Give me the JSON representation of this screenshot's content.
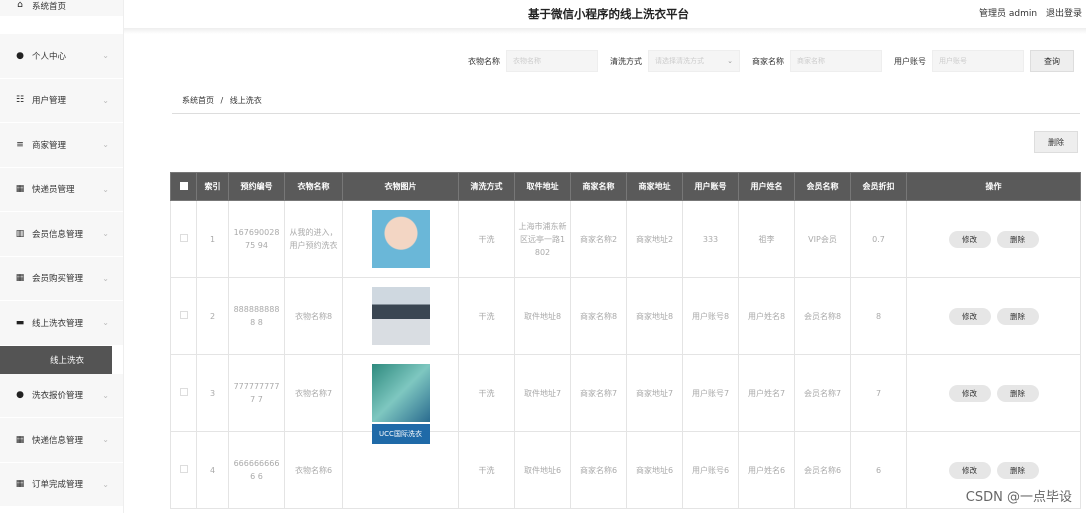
{
  "app": {
    "title": "基于微信小程序的线上洗衣平台",
    "user": "管理员 admin",
    "logout": "退出登录"
  },
  "sidebar": {
    "items": [
      {
        "label": "系统首页",
        "icon": "home-icon",
        "glyph": "⌂"
      },
      {
        "label": "个人中心",
        "icon": "user-icon",
        "glyph": "●"
      },
      {
        "label": "用户管理",
        "icon": "sliders-icon",
        "glyph": "☷"
      },
      {
        "label": "商家管理",
        "icon": "list-icon",
        "glyph": "≡"
      },
      {
        "label": "快递员管理",
        "icon": "grid-icon",
        "glyph": "▦"
      },
      {
        "label": "会员信息管理",
        "icon": "chart-icon",
        "glyph": "▥"
      },
      {
        "label": "会员购买管理",
        "icon": "grid-icon",
        "glyph": "▦"
      },
      {
        "label": "线上洗衣管理",
        "icon": "bag-icon",
        "glyph": "▬"
      },
      {
        "label": "洗衣报价管理",
        "icon": "user-icon",
        "glyph": "●"
      },
      {
        "label": "快递信息管理",
        "icon": "grid-icon",
        "glyph": "▦"
      },
      {
        "label": "订单完成管理",
        "icon": "grid-icon",
        "glyph": "▦"
      }
    ],
    "active_sub": "线上洗衣"
  },
  "search": {
    "f1_label": "衣物名称",
    "f1_placeholder": "衣物名称",
    "f2_label": "清洗方式",
    "f2_placeholder": "请选择清洗方式",
    "f3_label": "商家名称",
    "f3_placeholder": "商家名称",
    "f4_label": "用户账号",
    "f4_placeholder": "用户账号",
    "query": "查询"
  },
  "breadcrumb": {
    "home": "系统首页",
    "sep": "/",
    "current": "线上洗衣"
  },
  "toolbar": {
    "delete": "删除"
  },
  "table": {
    "headers": [
      "索引",
      "预约编号",
      "衣物名称",
      "衣物图片",
      "清洗方式",
      "取件地址",
      "商家名称",
      "商家地址",
      "用户账号",
      "用户姓名",
      "会员名称",
      "会员折扣",
      "操作"
    ],
    "edit_label": "修改",
    "delete_label": "删除",
    "rows": [
      {
        "idx": "1",
        "code": "16769002875 94",
        "name": "从我的进入，用户预约洗衣",
        "wash": "干洗",
        "addr": "上海市浦东新区远亭一路1802",
        "shop": "商家名称2",
        "shop_addr": "商家地址2",
        "acct": "333",
        "uname": "祖李",
        "vip": "VIP会员",
        "disc": "0.7",
        "img": "t1"
      },
      {
        "idx": "2",
        "code": "8888888888 8",
        "name": "衣物名称8",
        "wash": "干洗",
        "addr": "取件地址8",
        "shop": "商家名称8",
        "shop_addr": "商家地址8",
        "acct": "用户账号8",
        "uname": "用户姓名8",
        "vip": "会员名称8",
        "disc": "8",
        "img": "t2"
      },
      {
        "idx": "3",
        "code": "7777777777 7",
        "name": "衣物名称7",
        "wash": "干洗",
        "addr": "取件地址7",
        "shop": "商家名称7",
        "shop_addr": "商家地址7",
        "acct": "用户账号7",
        "uname": "用户姓名7",
        "vip": "会员名称7",
        "disc": "7",
        "img": "t3"
      },
      {
        "idx": "4",
        "code": "6666666666 6",
        "name": "衣物名称6",
        "wash": "干洗",
        "addr": "取件地址6",
        "shop": "商家名称6",
        "shop_addr": "商家地址6",
        "acct": "用户账号6",
        "uname": "用户姓名6",
        "vip": "会员名称6",
        "disc": "6",
        "img": "t4",
        "img_text": "UCC国际洗衣"
      }
    ]
  },
  "watermark": "CSDN @一点毕设"
}
